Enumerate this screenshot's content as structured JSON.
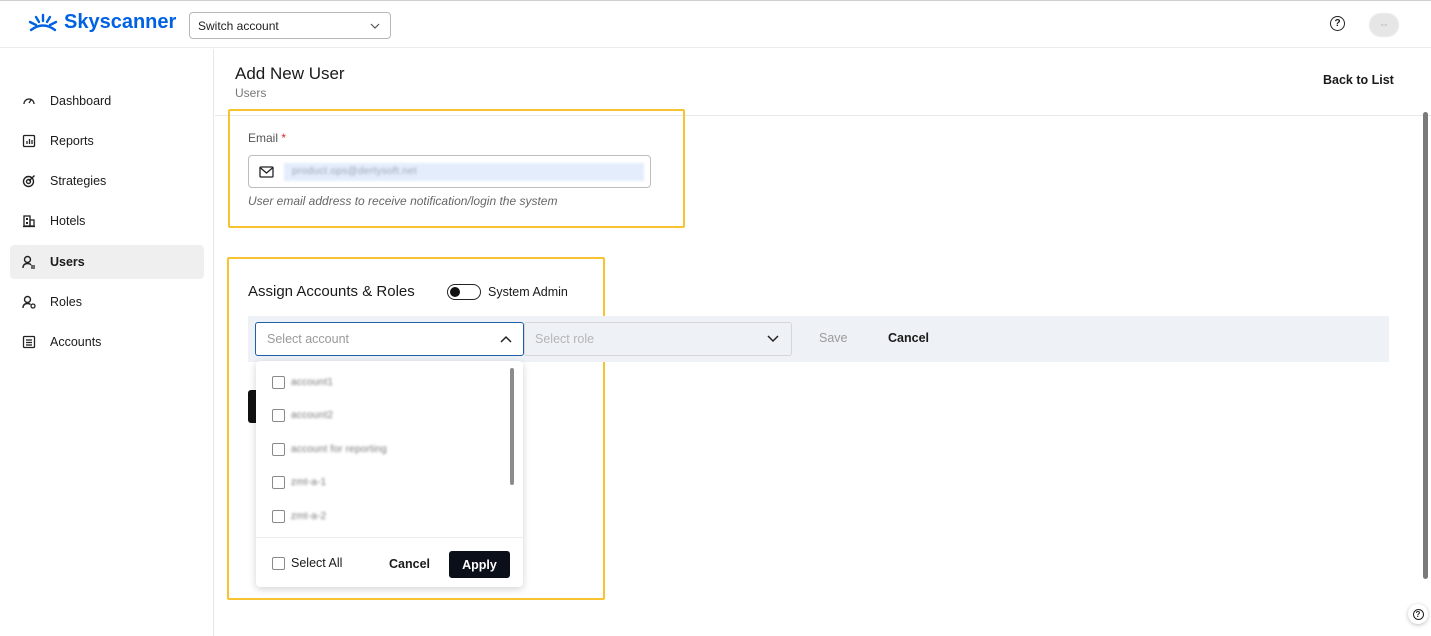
{
  "header": {
    "brand": "Skyscanner",
    "switch_account": "Switch account",
    "help_glyph": "?",
    "avatar_text": "··"
  },
  "sidebar": {
    "items": [
      {
        "label": "Dashboard",
        "icon": "dashboard-icon"
      },
      {
        "label": "Reports",
        "icon": "reports-icon"
      },
      {
        "label": "Strategies",
        "icon": "strategies-icon"
      },
      {
        "label": "Hotels",
        "icon": "hotels-icon"
      },
      {
        "label": "Users",
        "icon": "users-icon",
        "active": true
      },
      {
        "label": "Roles",
        "icon": "roles-icon"
      },
      {
        "label": "Accounts",
        "icon": "accounts-icon"
      }
    ]
  },
  "main": {
    "title": "Add New User",
    "breadcrumb": "Users",
    "back_link": "Back to List",
    "email": {
      "label": "Email",
      "required_mark": "*",
      "value": "product.ops@dertysoft.net",
      "help": "User email address to receive notification/login the system"
    },
    "assign": {
      "title": "Assign Accounts & Roles",
      "toggle_label": "System Admin",
      "toggle_on": false,
      "account_placeholder": "Select account",
      "role_placeholder": "Select role",
      "save_label": "Save",
      "cancel_label": "Cancel"
    },
    "account_dropdown": {
      "options": [
        "account1",
        "account2",
        "account for reporting",
        "zmt-a-1",
        "zmt-a-2"
      ],
      "select_all_label": "Select All",
      "cancel_label": "Cancel",
      "apply_label": "Apply"
    }
  },
  "colors": {
    "brand": "#0062e3",
    "highlight": "#f7c331",
    "primary_button": "#0b0f1a"
  }
}
